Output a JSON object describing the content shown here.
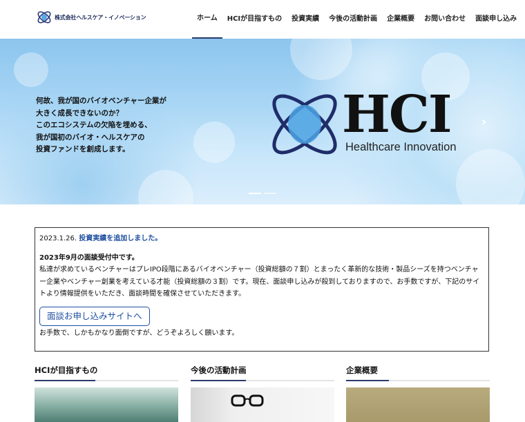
{
  "header": {
    "company_name": "株式会社ヘルスケア・イノベーション",
    "nav": [
      {
        "label": "ホーム",
        "active": true
      },
      {
        "label": "HCIが目指すもの",
        "active": false
      },
      {
        "label": "投資実績",
        "active": false
      },
      {
        "label": "今後の活動計画",
        "active": false
      },
      {
        "label": "企業概要",
        "active": false
      },
      {
        "label": "お問い合わせ",
        "active": false
      },
      {
        "label": "面談申し込み",
        "active": false
      }
    ]
  },
  "hero": {
    "lines": [
      "何故、我が国のバイオベンチャー企業が",
      "大きく成長できないのか？",
      "このエコシステムの欠陥を埋める、",
      "我が国初のバイオ・ヘルスケアの",
      "投資ファンドを創成します。"
    ],
    "logo_letters": "HCI",
    "logo_sub": "Healthcare Innovation",
    "next_arrow": "›",
    "slides": 2,
    "active_slide": 1
  },
  "news": {
    "date": "2023.1.26.",
    "link_text": "投資実績を追加しました。",
    "heading": "2023年9月の面談受付中です。",
    "body": "私達が求めているベンチャーはプレIPO段階にあるバイオベンチャー（投資総額の７割）とまったく革新的な技術・製品シーズを持つベンチャー企業やベンチャー創業を考えている才能（投資総額の３割）です。現在、面談申し込みが殺到しておりますので、お手数ですが、下記のサイトより情報提供をいただき、面談時間を確保させていただきます。",
    "button_label": "面談お申し込みサイトへ",
    "footer": "お手数で、しかもかなり面倒ですが、どうぞよろしく願います。"
  },
  "cards": [
    {
      "title": "HCIが目指すもの"
    },
    {
      "title": "今後の活動計画"
    },
    {
      "title": "企業概要"
    }
  ],
  "colors": {
    "accent": "#2a3a6a",
    "link": "#1f4fa0"
  }
}
